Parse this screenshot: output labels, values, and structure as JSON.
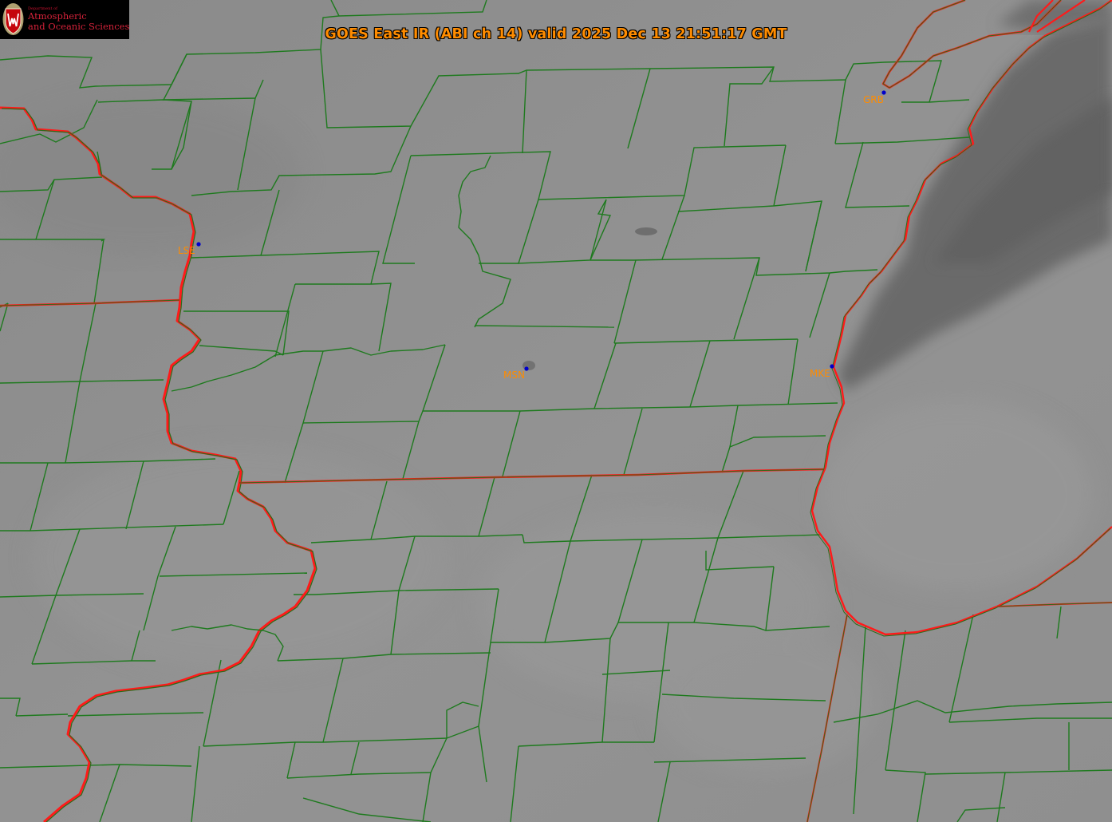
{
  "title": "GOES East IR (ABI ch 14) valid 2025 Dec 13 21:51:17 GMT",
  "logo": {
    "department_small": "Department of",
    "line1": "Atmospheric",
    "line2": "and Oceanic Sciences"
  },
  "stations": [
    {
      "id": "LSE",
      "label": "LSE"
    },
    {
      "id": "MSN",
      "label": "MSN"
    },
    {
      "id": "MKE",
      "label": "MKE"
    },
    {
      "id": "GRB",
      "label": "GRB"
    }
  ],
  "colors": {
    "county_lines": "#1e7a1e",
    "state_lines": "#ff1a1a",
    "label_text": "#ff8c00",
    "station_dot": "#0000cc",
    "background_land": "#8e8e8e",
    "lake_clouds": "#6a6a6a"
  }
}
